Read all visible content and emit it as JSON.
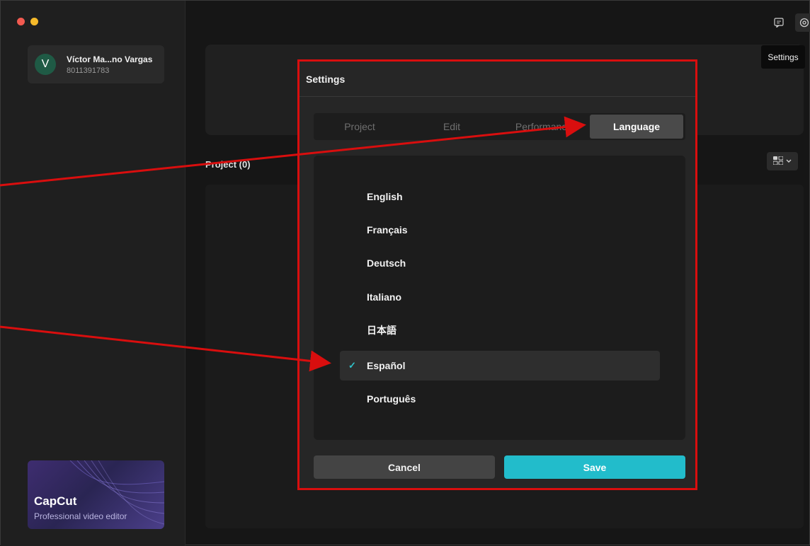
{
  "user": {
    "initial": "V",
    "name": "Víctor Ma...no Vargas",
    "id": "8011391783"
  },
  "promo": {
    "brand": "CapCut",
    "subtitle": "Professional video editor"
  },
  "main": {
    "project_label": "Project  (0)"
  },
  "tooltip": "Settings",
  "dialog": {
    "title": "Settings",
    "tabs": [
      "Project",
      "Edit",
      "Performance",
      "Language"
    ],
    "active_tab": "Language",
    "languages": [
      "English",
      "Français",
      "Deutsch",
      "Italiano",
      "日本語",
      "Español",
      "Português"
    ],
    "selected_language": "Español",
    "cancel": "Cancel",
    "save": "Save"
  },
  "colors": {
    "accent": "#22bccb",
    "annotation": "#d90e0e"
  },
  "icons": [
    "feedback-icon",
    "settings-icon",
    "grid-view-icon",
    "chevron-down-icon",
    "checkmark-icon"
  ]
}
